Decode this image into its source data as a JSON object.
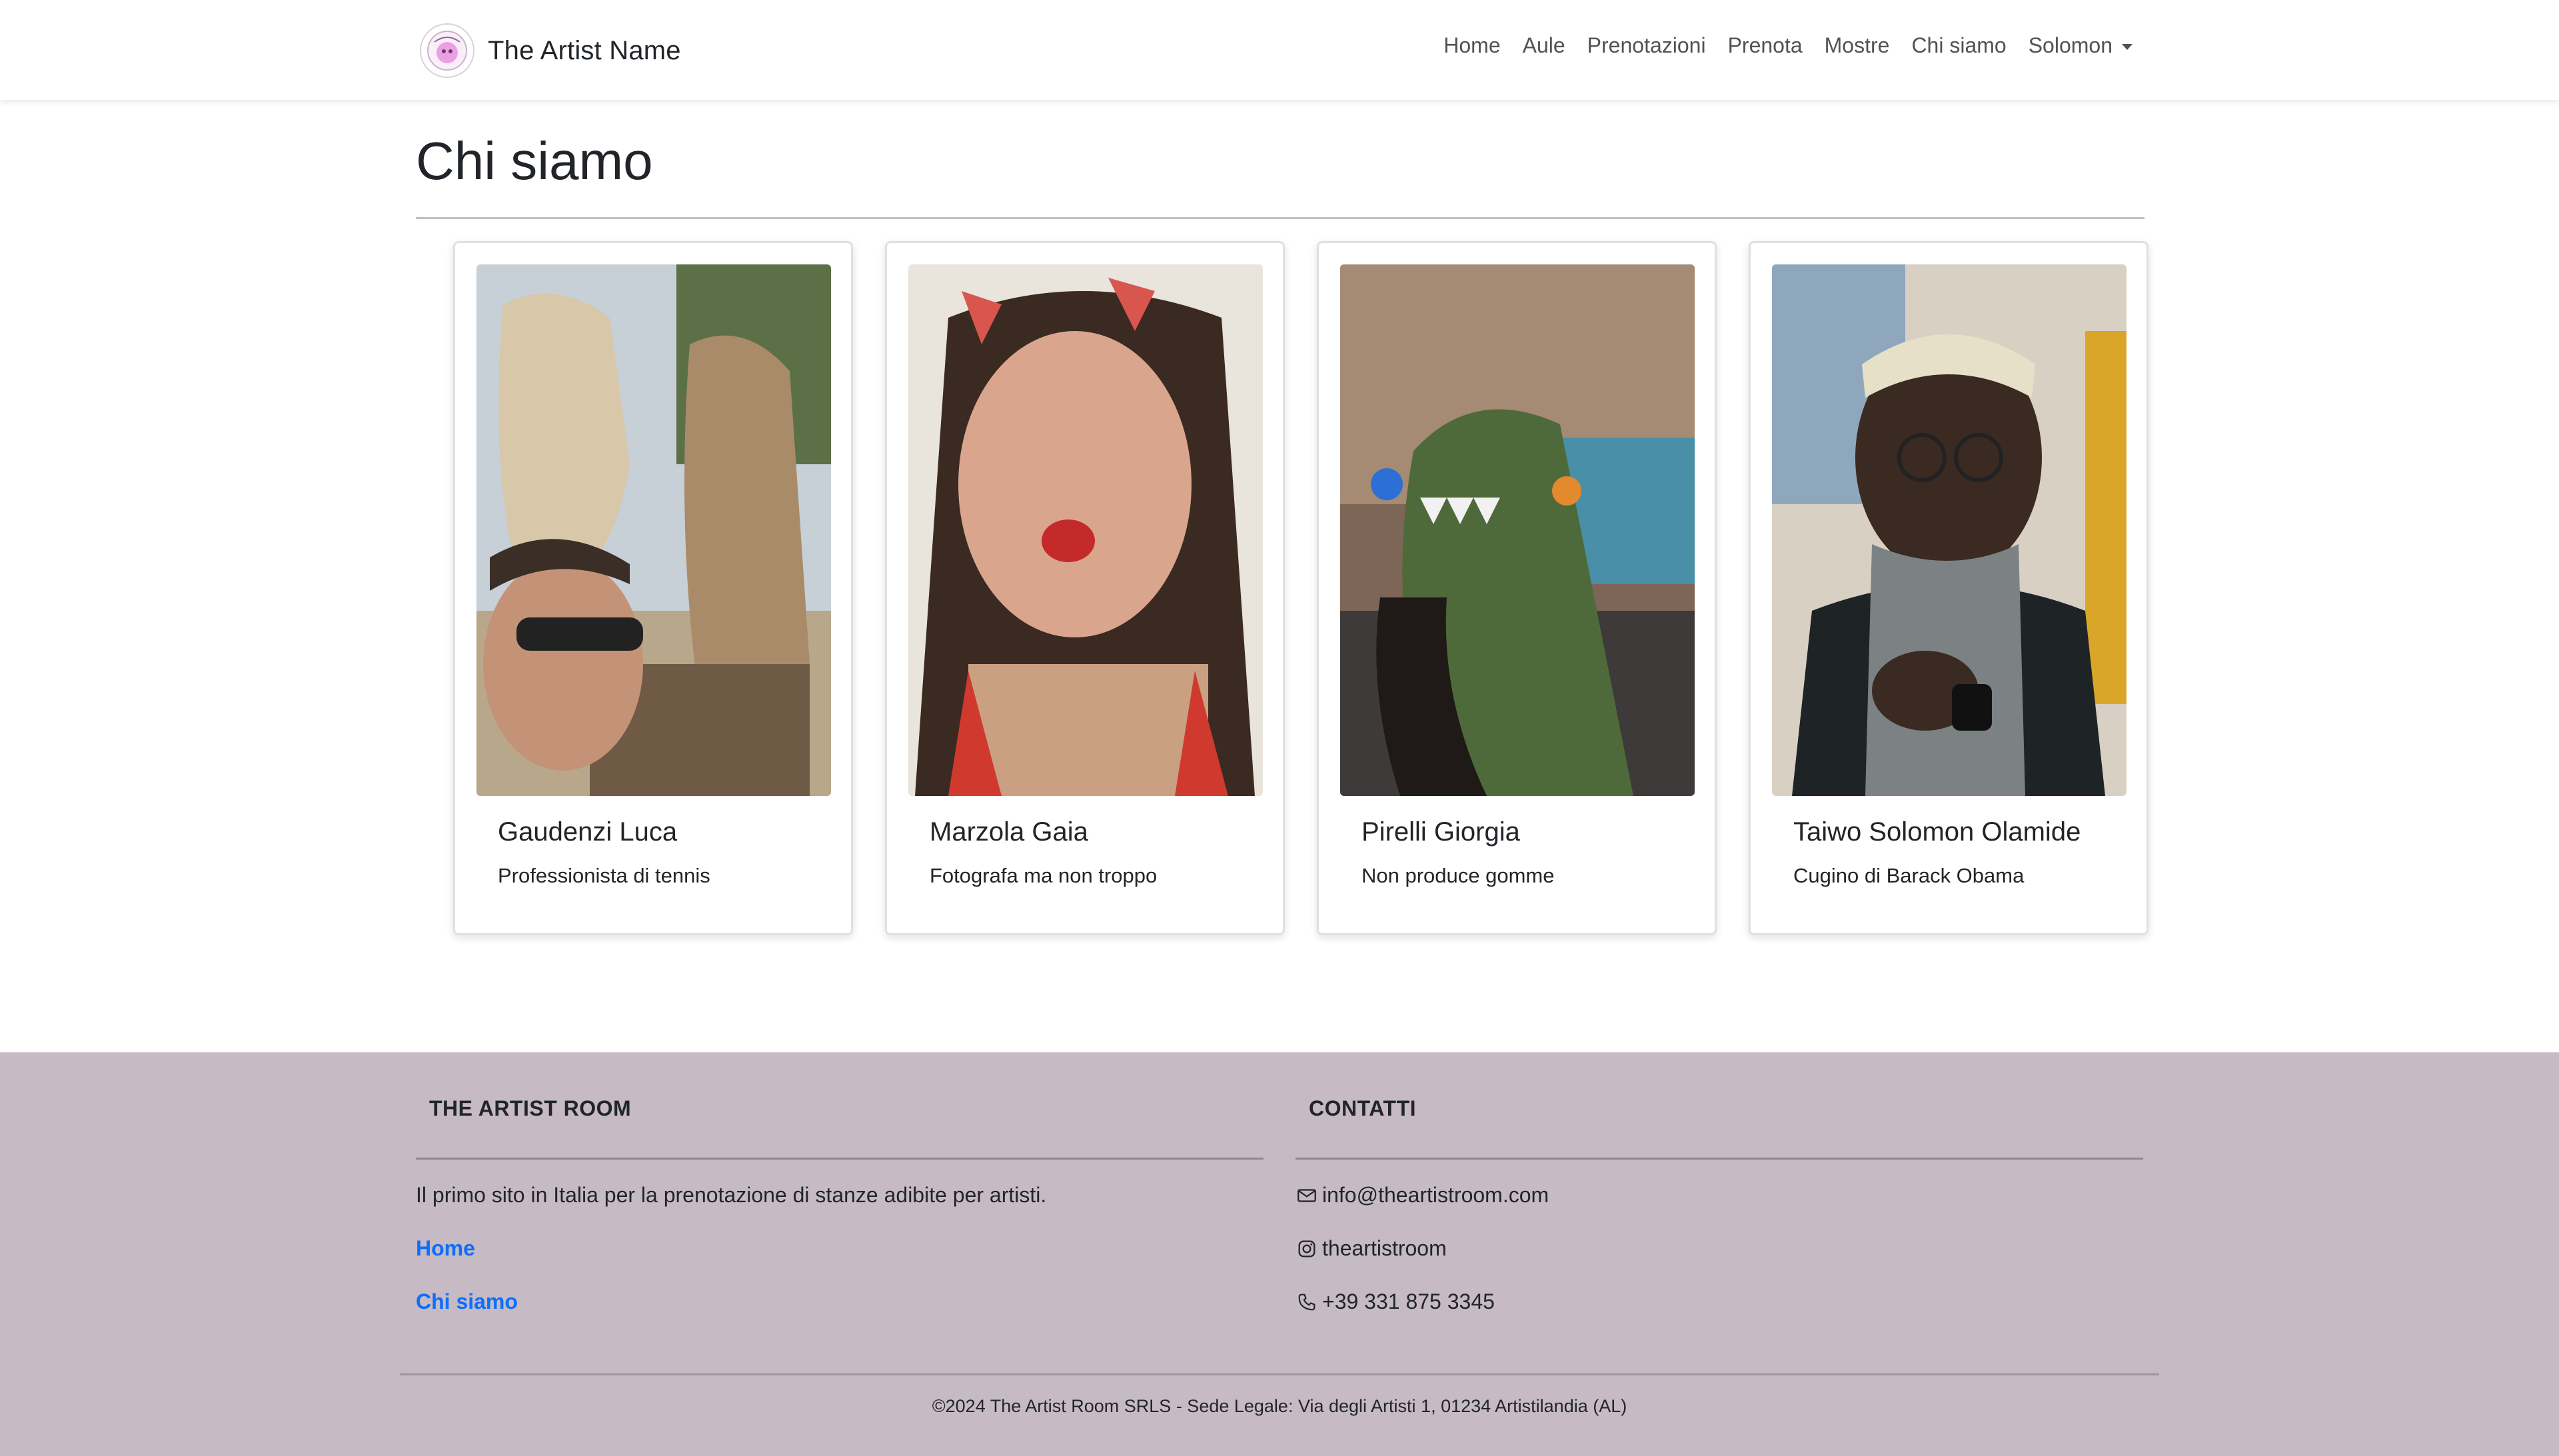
{
  "navbar": {
    "brand": "The Artist Name",
    "links": [
      "Home",
      "Aule",
      "Prenotazioni",
      "Prenota",
      "Mostre",
      "Chi siamo"
    ],
    "user_menu": "Solomon"
  },
  "main": {
    "title": "Chi siamo",
    "team": [
      {
        "name": "Gaudenzi Luca",
        "role": "Professionista di tennis"
      },
      {
        "name": "Marzola Gaia",
        "role": "Fotografa ma non troppo"
      },
      {
        "name": "Pirelli Giorgia",
        "role": "Non produce gomme"
      },
      {
        "name": "Taiwo Solomon Olamide",
        "role": "Cugino di Barack Obama"
      }
    ]
  },
  "footer": {
    "about": {
      "heading": "THE ARTIST ROOM",
      "description": "Il primo sito in Italia per la prenotazione di stanze adibite per artisti.",
      "links": [
        "Home",
        "Chi siamo"
      ]
    },
    "contacts": {
      "heading": "CONTATTI",
      "email": "info@theartistroom.com",
      "instagram": "theartistroom",
      "phone": "+39 331 875 3345"
    },
    "copyright": "©2024 The Artist Room SRLS - Sede Legale: Via degli Artisti 1, 01234 Artistilandia (AL)"
  },
  "icons": {
    "email": "envelope-icon",
    "instagram": "instagram-icon",
    "phone": "phone-icon"
  },
  "colors": {
    "footer_bg": "#c6bac5",
    "link": "#0d6efd"
  }
}
